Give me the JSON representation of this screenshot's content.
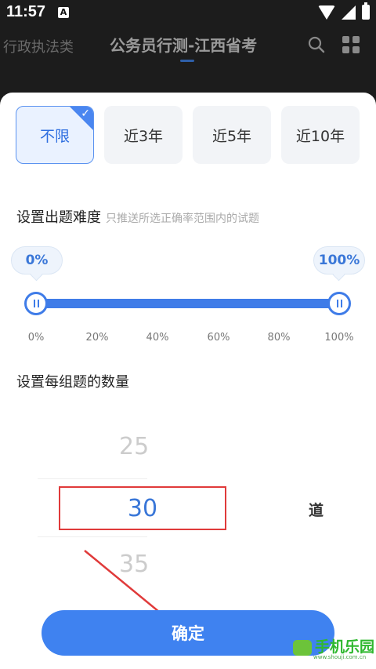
{
  "status_bar": {
    "time": "11:57",
    "notif_icon": "A"
  },
  "top_nav": {
    "left_tab": "行政执法类",
    "title": "公务员行测-江西省考",
    "search_icon": "search-icon",
    "grid_icon": "apps-grid-icon"
  },
  "year_filter": {
    "options": [
      {
        "label": "不限",
        "selected": true
      },
      {
        "label": "近3年",
        "selected": false
      },
      {
        "label": "近5年",
        "selected": false
      },
      {
        "label": "近10年",
        "selected": false
      }
    ]
  },
  "difficulty": {
    "title": "设置出题难度",
    "hint": "只推送所选正确率范围内的试题",
    "min_label": "0%",
    "max_label": "100%",
    "range": [
      0,
      100
    ],
    "ticks": [
      "0%",
      "20%",
      "40%",
      "60%",
      "80%",
      "100%"
    ]
  },
  "count": {
    "title": "设置每组题的数量",
    "prev": "25",
    "selected": "30",
    "next": "35",
    "unit": "道"
  },
  "confirm_label": "确定",
  "watermark": {
    "text": "手机乐园",
    "sub": "www.shouji.com.cn"
  },
  "colors": {
    "accent": "#3f82f0",
    "highlight_box": "#e03a3a"
  }
}
